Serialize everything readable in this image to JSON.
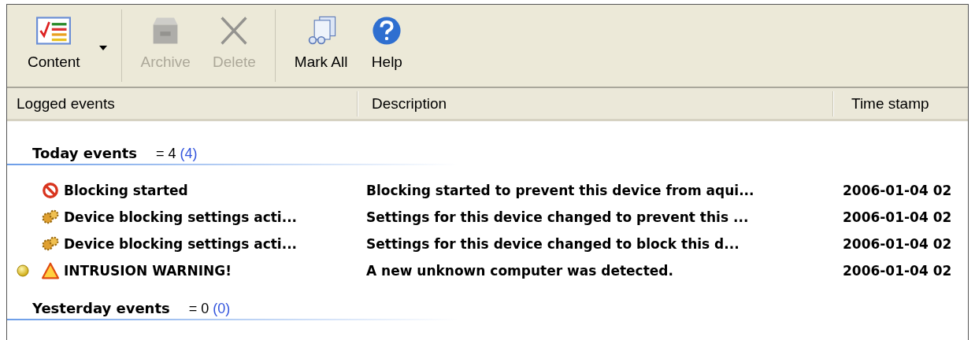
{
  "toolbar": [
    {
      "label": "Content",
      "kind": "content",
      "disabled": false,
      "dropdown": true
    },
    {
      "label": "Archive",
      "kind": "archive",
      "disabled": true,
      "dropdown": false
    },
    {
      "label": "Delete",
      "kind": "delete",
      "disabled": true,
      "dropdown": false
    },
    {
      "label": "Mark All",
      "kind": "markall",
      "disabled": false,
      "dropdown": false
    },
    {
      "label": "Help",
      "kind": "help",
      "disabled": false,
      "dropdown": false
    }
  ],
  "table": {
    "columns": [
      "Logged events",
      "Description",
      "Time stamp"
    ],
    "groups": [
      {
        "title": "Today events",
        "count": "= 4",
        "total": "(4)",
        "rows": [
          {
            "kind": "blocked",
            "marked": false,
            "event": "Blocking started",
            "description": "Blocking started to prevent this device from aqui...",
            "time": "2006-01-04 02"
          },
          {
            "kind": "settings",
            "marked": false,
            "event": "Device blocking settings acti...",
            "description": "Settings for this device changed to prevent this ...",
            "time": "2006-01-04 02"
          },
          {
            "kind": "settings",
            "marked": false,
            "event": "Device blocking settings acti...",
            "description": "Settings for this device changed to block this d...",
            "time": "2006-01-04 02"
          },
          {
            "kind": "warning",
            "marked": true,
            "event": "INTRUSION WARNING!",
            "description": "A new unknown computer was detected.",
            "time": "2006-01-04 02"
          }
        ]
      },
      {
        "title": "Yesterday events",
        "count": "= 0",
        "total": "(0)"
      }
    ]
  }
}
